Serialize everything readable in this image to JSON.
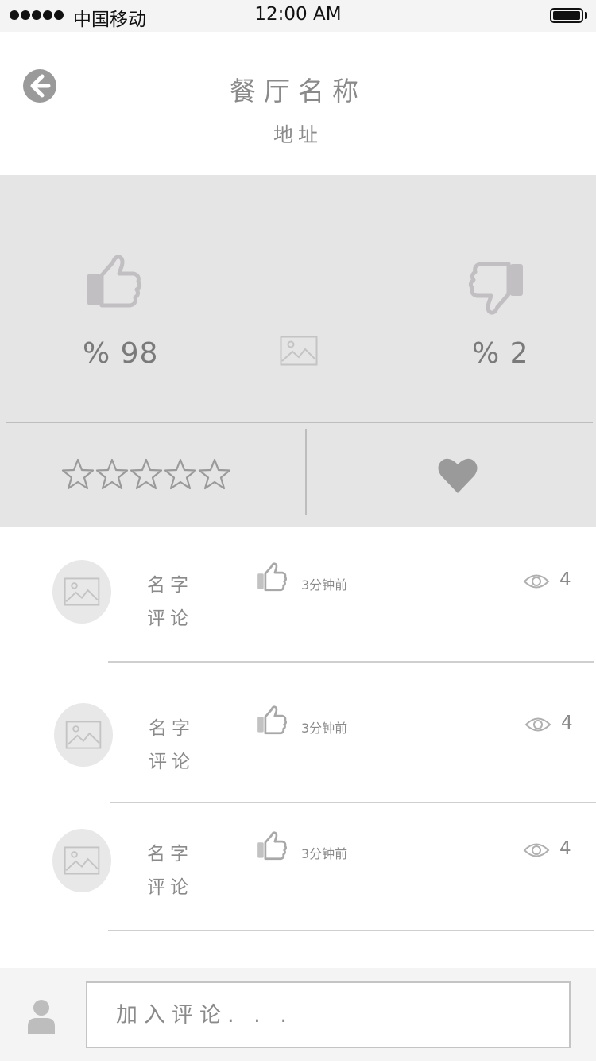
{
  "status_bar": {
    "carrier": "中国移动",
    "time": "12:00 AM"
  },
  "header": {
    "title": "餐厅名称",
    "subtitle": "地址",
    "back_icon": "arrow-left-circle-icon"
  },
  "summary": {
    "like_percent_label": "% 98",
    "dislike_percent_label": "% 2",
    "like_percent": 98,
    "dislike_percent": 2,
    "star_rating": 0,
    "star_count": 5,
    "favorite_icon": "heart-icon"
  },
  "comments": [
    {
      "name": "名字",
      "text": "评论",
      "time": "3分钟前",
      "views": "4"
    },
    {
      "name": "名字",
      "text": "评论",
      "time": "3分钟前",
      "views": "4"
    },
    {
      "name": "名字",
      "text": "评论",
      "time": "3分钟前",
      "views": "4"
    }
  ],
  "footer": {
    "input_placeholder": "加入评论. . ."
  },
  "colors": {
    "panel_bg": "#e5e5e5",
    "icon_gray": "#c2c2c2",
    "text_gray": "#8a8a8a"
  }
}
